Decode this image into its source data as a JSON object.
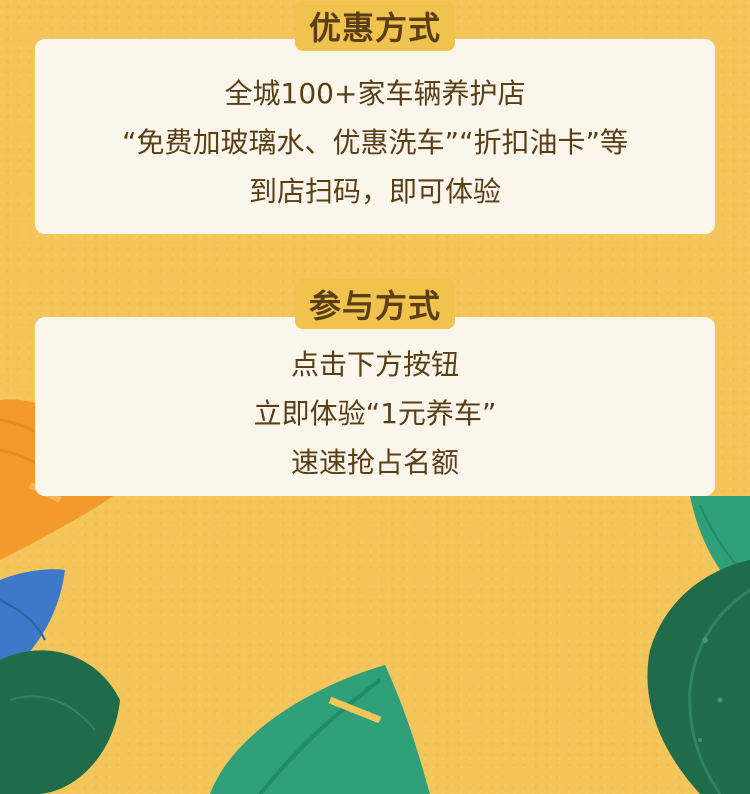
{
  "sections": [
    {
      "title": "优惠方式",
      "lines": [
        "全城100+家车辆养护店",
        "“免费加玻璃水、优惠洗车”“折扣油卡”等",
        "到店扫码，即可体验"
      ]
    },
    {
      "title": "参与方式",
      "lines": [
        "点击下方按钮",
        "立即体验“1元养车”",
        "速速抢占名额"
      ]
    }
  ],
  "colors": {
    "background": "#F3C55A",
    "card": "#FBF6EC",
    "text": "#5A3E16",
    "leaf_orange": "#F39A2C",
    "leaf_blue": "#3E78C8",
    "leaf_dark_green": "#1F6B4A",
    "leaf_green": "#2FA07A"
  }
}
